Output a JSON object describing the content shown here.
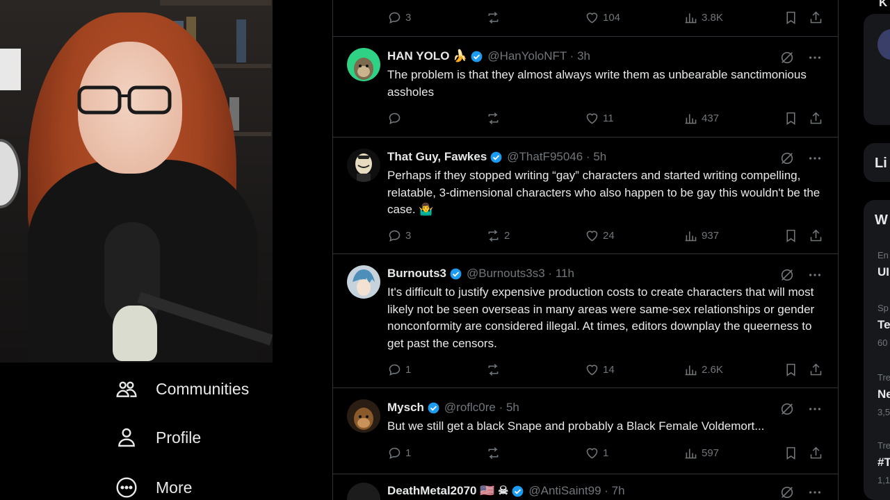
{
  "nav": {
    "communities": "Communities",
    "profile": "Profile",
    "more": "More"
  },
  "top_actions": {
    "replies": "3",
    "retweets": "",
    "likes": "104",
    "views": "3.8K"
  },
  "tweets": [
    {
      "name": "HAN YOLO 🍌",
      "handle": "@HanYoloNFT · 3h",
      "text": "The problem is that they almost always write them as unbearable sanctimonious assholes",
      "replies": "",
      "retweets": "",
      "likes": "11",
      "views": "437"
    },
    {
      "name": "That Guy, Fawkes",
      "handle": "@ThatF95046 · 5h",
      "text": "Perhaps if they stopped writing “gay” characters and started writing compelling, relatable, 3-dimensional characters who also happen to be gay this wouldn't be the case. 🤷‍♂️",
      "replies": "3",
      "retweets": "2",
      "likes": "24",
      "views": "937"
    },
    {
      "name": "Burnouts3",
      "handle": "@Burnouts3s3 · 11h",
      "text": "It's difficult to justify expensive production costs to create characters that will most likely not be seen overseas in many areas were same-sex relationships or gender nonconformity are considered illegal. At times, editors downplay the queerness to get past the censors.",
      "replies": "1",
      "retweets": "",
      "likes": "14",
      "views": "2.6K"
    },
    {
      "name": "Mysch",
      "handle": "@roflc0re · 5h",
      "text": "But we still get a black Snape and probably a Black Female Voldemort...",
      "replies": "1",
      "retweets": "",
      "likes": "1",
      "views": "597"
    },
    {
      "name": "DeathMetal2070 🇺🇸 ☠",
      "handle": "@AntiSaint99 · 7h",
      "text": "",
      "replies": "",
      "retweets": "",
      "likes": "",
      "views": ""
    }
  ],
  "right": {
    "r1": "K",
    "r2": "Li",
    "r3": "W",
    "r4a": "En",
    "r4b": "UI",
    "r5a": "Sp",
    "r5b": "Te",
    "r5c": "60",
    "r6a": "Tre",
    "r6b": "Ne",
    "r6c": "3,5",
    "r7a": "Tre",
    "r7b": "#T",
    "r7c": "1,1"
  },
  "colors": {
    "verified": "#1d9bf0",
    "muted": "#71767b",
    "border": "#2f3336"
  }
}
